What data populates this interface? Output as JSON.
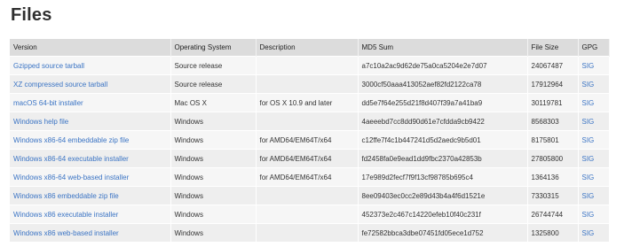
{
  "page": {
    "title": "Files"
  },
  "table": {
    "headers": [
      "Version",
      "Operating System",
      "Description",
      "MD5 Sum",
      "File Size",
      "GPG"
    ],
    "rows": [
      {
        "version": "Gzipped source tarball",
        "os": "Source release",
        "description": "",
        "md5": "a7c10a2ac9d62de75a0ca5204e2e7d07",
        "size": "24067487",
        "gpg": "SIG"
      },
      {
        "version": "XZ compressed source tarball",
        "os": "Source release",
        "description": "",
        "md5": "3000cf50aaa413052aef82fd2122ca78",
        "size": "17912964",
        "gpg": "SIG"
      },
      {
        "version": "macOS 64-bit installer",
        "os": "Mac OS X",
        "description": "for OS X 10.9 and later",
        "md5": "dd5e7f64e255d21f8d407f39a7a41ba9",
        "size": "30119781",
        "gpg": "SIG"
      },
      {
        "version": "Windows help file",
        "os": "Windows",
        "description": "",
        "md5": "4aeeebd7cc8dd90d61e7cfdda9cb9422",
        "size": "8568303",
        "gpg": "SIG"
      },
      {
        "version": "Windows x86-64 embeddable zip file",
        "os": "Windows",
        "description": "for AMD64/EM64T/x64",
        "md5": "c12ffe7f4c1b447241d5d2aedc9b5d01",
        "size": "8175801",
        "gpg": "SIG"
      },
      {
        "version": "Windows x86-64 executable installer",
        "os": "Windows",
        "description": "for AMD64/EM64T/x64",
        "md5": "fd2458fa0e9ead1dd9fbc2370a42853b",
        "size": "27805800",
        "gpg": "SIG"
      },
      {
        "version": "Windows x86-64 web-based installer",
        "os": "Windows",
        "description": "for AMD64/EM64T/x64",
        "md5": "17e989d2fecf7f9f13cf98785b695c4",
        "size": "1364136",
        "gpg": "SIG"
      },
      {
        "version": "Windows x86 embeddable zip file",
        "os": "Windows",
        "description": "",
        "md5": "8ee09403ec0cc2e89d43b4a4f6d1521e",
        "size": "7330315",
        "gpg": "SIG"
      },
      {
        "version": "Windows x86 executable installer",
        "os": "Windows",
        "description": "",
        "md5": "452373e2c467c14220efeb10f40c231f",
        "size": "26744744",
        "gpg": "SIG"
      },
      {
        "version": "Windows x86 web-based installer",
        "os": "Windows",
        "description": "",
        "md5": "fe72582bbca3dbe07451fd05ece1d752",
        "size": "1325800",
        "gpg": "SIG"
      }
    ]
  }
}
